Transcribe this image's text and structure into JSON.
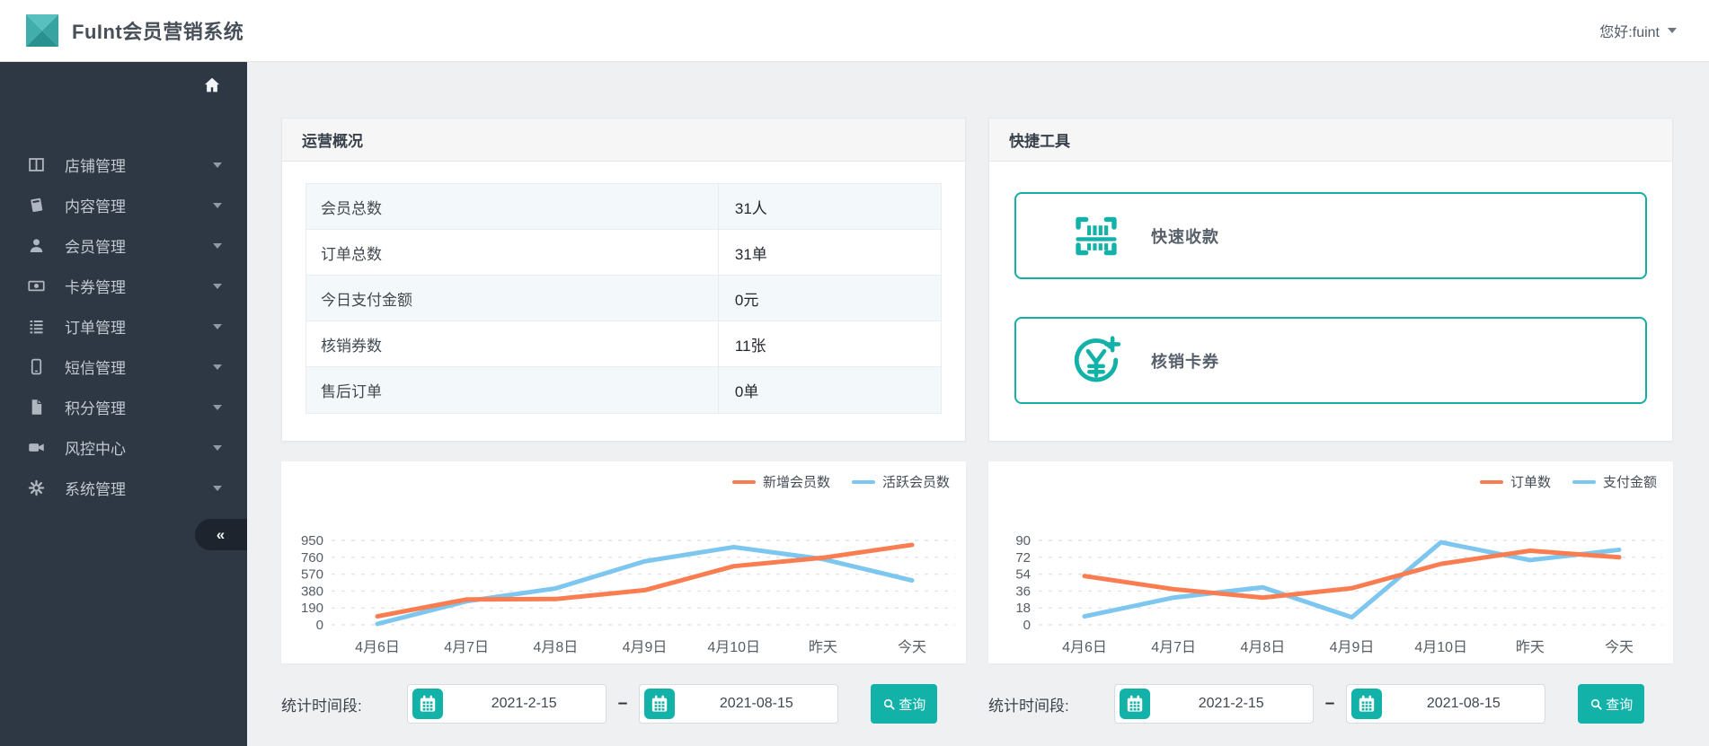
{
  "header": {
    "app_title": "FuInt会员营销系统",
    "user_greeting": "您好:fuint"
  },
  "sidebar": {
    "home_icon": "home-icon",
    "collapse_icon": "«",
    "items": [
      {
        "label": "店铺管理",
        "icon": "store-icon"
      },
      {
        "label": "内容管理",
        "icon": "book-icon"
      },
      {
        "label": "会员管理",
        "icon": "member-icon"
      },
      {
        "label": "卡券管理",
        "icon": "coupon-icon"
      },
      {
        "label": "订单管理",
        "icon": "order-list-icon"
      },
      {
        "label": "短信管理",
        "icon": "sms-icon"
      },
      {
        "label": "积分管理",
        "icon": "points-file-icon"
      },
      {
        "label": "风控中心",
        "icon": "risk-camera-icon"
      },
      {
        "label": "系统管理",
        "icon": "settings-gear-icon"
      }
    ]
  },
  "overview_panel": {
    "title": "运营概况",
    "rows": [
      {
        "label": "会员总数",
        "value": "31人"
      },
      {
        "label": "订单总数",
        "value": "31单"
      },
      {
        "label": "今日支付金额",
        "value": "0元"
      },
      {
        "label": "核销券数",
        "value": "11张"
      },
      {
        "label": "售后订单",
        "value": "0单"
      }
    ]
  },
  "quick_tools_panel": {
    "title": "快捷工具",
    "buttons": [
      {
        "label": "快速收款",
        "icon": "barcode-scan-icon"
      },
      {
        "label": "核销卡券",
        "icon": "yen-plus-icon"
      }
    ]
  },
  "chart_data": [
    {
      "type": "line",
      "title": "",
      "legend_position": "top-right",
      "grid": "dashed-horizontal",
      "categories": [
        "4月6日",
        "4月7日",
        "4月8日",
        "4月9日",
        "4月10日",
        "昨天",
        "今天"
      ],
      "yticks": [
        0,
        190,
        380,
        570,
        760,
        950
      ],
      "ylim": [
        0,
        950
      ],
      "series": [
        {
          "name": "新增会员数",
          "color": "#f97d51",
          "values": [
            95,
            285,
            290,
            390,
            660,
            755,
            900
          ]
        },
        {
          "name": "活跃会员数",
          "color": "#7cc6ef",
          "values": [
            10,
            265,
            410,
            715,
            875,
            740,
            500
          ]
        }
      ]
    },
    {
      "type": "line",
      "title": "",
      "legend_position": "top-right",
      "grid": "dashed-horizontal",
      "categories": [
        "4月6日",
        "4月7日",
        "4月8日",
        "4月9日",
        "4月10日",
        "昨天",
        "今天"
      ],
      "yticks": [
        0,
        18,
        36,
        54,
        72,
        90
      ],
      "ylim": [
        0,
        90
      ],
      "series": [
        {
          "name": "订单数",
          "color": "#f97d51",
          "values": [
            52,
            38,
            29,
            39,
            65,
            79,
            72
          ]
        },
        {
          "name": "支付金额",
          "color": "#7cc6ef",
          "values": [
            9,
            29,
            40,
            8,
            88,
            69,
            80
          ]
        }
      ]
    }
  ],
  "filters": [
    {
      "label": "统计时间段:",
      "start_date": "2021-2-15",
      "separator": "–",
      "end_date": "2021-08-15",
      "search_label": "查询"
    },
    {
      "label": "统计时间段:",
      "start_date": "2021-2-15",
      "separator": "–",
      "end_date": "2021-08-15",
      "search_label": "查询"
    }
  ],
  "colors": {
    "accent_teal": "#12b2a9",
    "quick_button_border": "#14aea5",
    "sidebar_bg": "#2e3844",
    "series_orange": "#f97d51",
    "series_blue": "#7cc6ef",
    "page_bg": "#eef0f2",
    "table_stripe": "#f3f8fb"
  }
}
